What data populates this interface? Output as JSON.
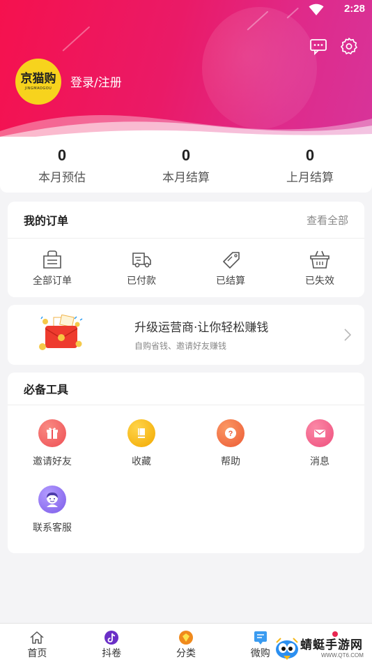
{
  "status_bar": {
    "time": "2:28"
  },
  "header": {
    "logo_text": "京猫购",
    "logo_sub": "JINGMAOGOU",
    "login_label": "登录/注册"
  },
  "stats": [
    {
      "value": "0",
      "label": "本月预估"
    },
    {
      "value": "0",
      "label": "本月结算"
    },
    {
      "value": "0",
      "label": "上月结算"
    }
  ],
  "orders": {
    "title": "我的订单",
    "view_all": "查看全部",
    "items": [
      {
        "label": "全部订单",
        "icon": "shopping-bag-icon"
      },
      {
        "label": "已付款",
        "icon": "delivery-truck-icon"
      },
      {
        "label": "已结算",
        "icon": "sale-tag-icon"
      },
      {
        "label": "已失效",
        "icon": "basket-icon"
      }
    ]
  },
  "promo": {
    "title": "升级运营商·让你轻松赚钱",
    "subtitle": "自购省钱、邀请好友赚钱",
    "icon": "red-envelope-icon"
  },
  "tools": {
    "title": "必备工具",
    "items": [
      {
        "label": "邀请好友",
        "icon": "gift-icon",
        "color": "#f2545b"
      },
      {
        "label": "收藏",
        "icon": "bookmark-icon",
        "color": "#f6b400"
      },
      {
        "label": "帮助",
        "icon": "help-icon",
        "color": "#f26b3a"
      },
      {
        "label": "消息",
        "icon": "mail-icon",
        "color": "#f05a86"
      },
      {
        "label": "联系客服",
        "icon": "support-avatar-icon",
        "color": "#8a6cf0"
      }
    ]
  },
  "bottom_nav": [
    {
      "label": "首页",
      "icon": "home-icon"
    },
    {
      "label": "抖卷",
      "icon": "tiktok-icon"
    },
    {
      "label": "分类",
      "icon": "category-icon"
    },
    {
      "label": "微购",
      "icon": "wechat-buy-icon"
    },
    {
      "label": "",
      "icon": "profile-icon"
    }
  ],
  "watermark": {
    "text": "蜻蜓手游网",
    "url": "WWW.QT6.COM"
  },
  "colors": {
    "accent": "#ec1b5e",
    "header_end": "#d7349a",
    "avatar": "#f7d31d"
  }
}
